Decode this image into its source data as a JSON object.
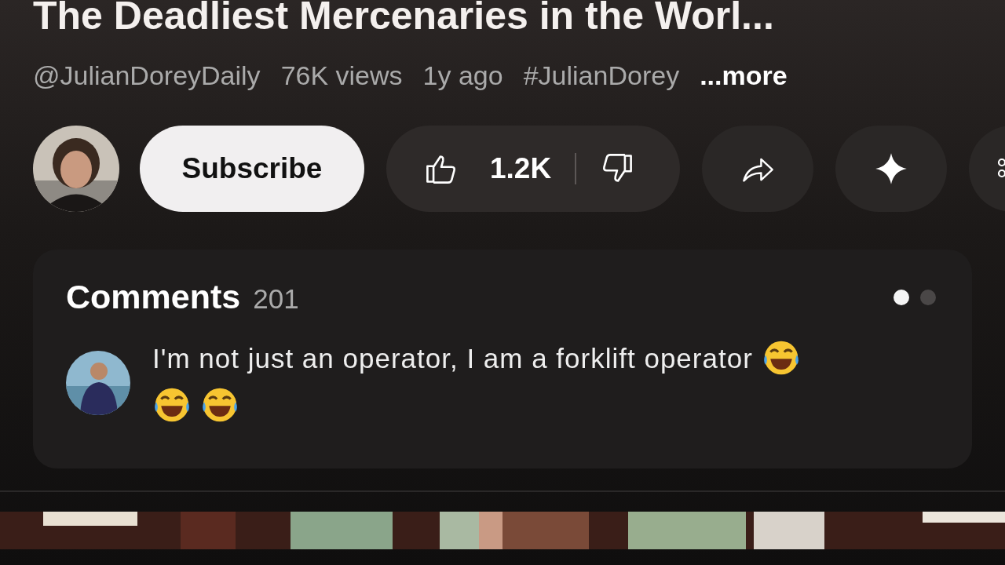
{
  "video": {
    "title": "The Deadliest Mercenaries in the Worl...",
    "channel_handle": "@JulianDoreyDaily",
    "views": "76K views",
    "age": "1y ago",
    "hashtag": "#JulianDorey",
    "more": "...more"
  },
  "actions": {
    "subscribe": "Subscribe",
    "likes": "1.2K"
  },
  "comments": {
    "title": "Comments",
    "count": "201",
    "pages": [
      {
        "selected": true
      },
      {
        "selected": false
      }
    ],
    "top_comment": {
      "text": "I'm not just an operator, I am a forklift operator",
      "reactions": [
        {
          "kind": "laugh"
        },
        {
          "kind": "laugh"
        },
        {
          "kind": "laugh"
        }
      ]
    }
  }
}
